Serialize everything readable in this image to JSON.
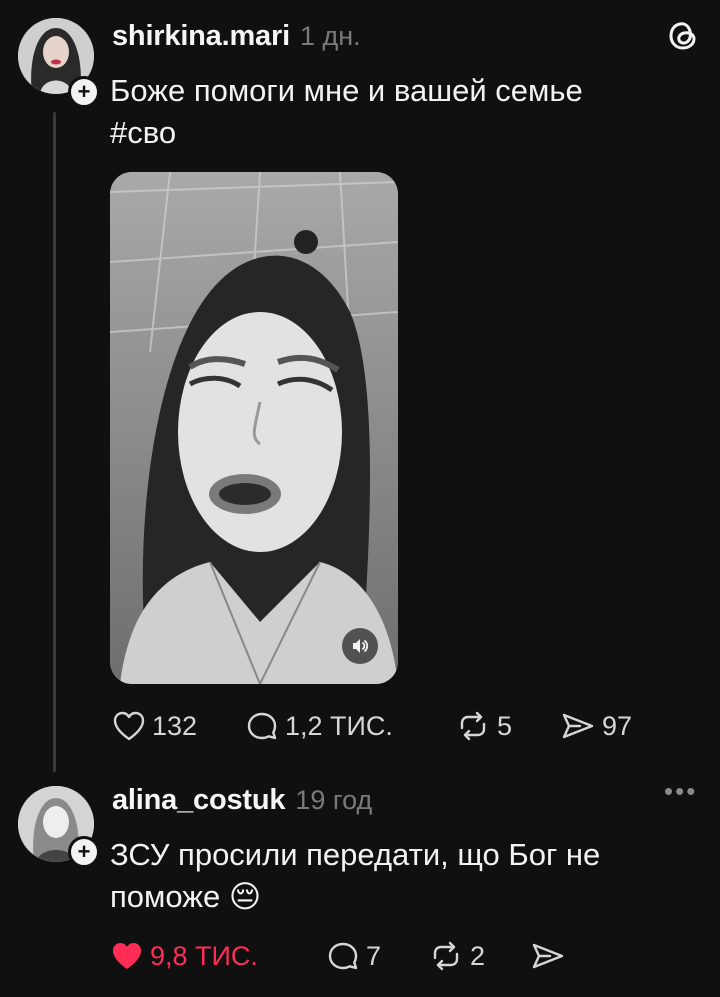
{
  "post": {
    "username": "shirkina.mari",
    "timestamp": "1 дн.",
    "text_line1": "Боже помоги мне и вашей семье",
    "text_line2": "#сво",
    "likes": "132",
    "replies": "1,2 ТИС.",
    "reposts": "5",
    "shares": "97"
  },
  "reply": {
    "username": "alina_costuk",
    "timestamp": "19 год",
    "text_line1": "ЗСУ просили передати, що Бог не",
    "text_line2": "поможе",
    "emoji": "😔",
    "likes": "9,8 ТИС.",
    "replies": "7",
    "reposts": "2"
  },
  "icons": {
    "app": "threads-icon",
    "like": "heart-icon",
    "reply": "comment-icon",
    "repost": "repost-icon",
    "share": "send-icon",
    "sound": "speaker-icon",
    "more": "more-icon"
  },
  "colors": {
    "background": "#101010",
    "liked": "#ff2d55",
    "muted": "#7a7a7a"
  }
}
